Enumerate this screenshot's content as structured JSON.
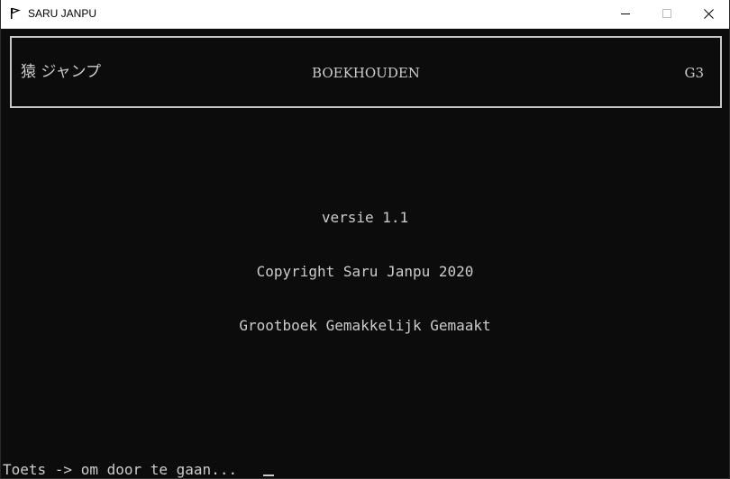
{
  "window": {
    "title": "SARU JANPU",
    "icon": "flag-icon",
    "controls": {
      "minimize_icon": "minimize-icon",
      "maximize_icon": "maximize-icon",
      "close_icon": "close-icon"
    }
  },
  "header": {
    "brand": "猿 ジャンプ",
    "title": "BOEKHOUDEN",
    "code": "G3"
  },
  "body": {
    "version": "versie 1.1",
    "copyright": "Copyright Saru Janpu 2020",
    "tagline": "Grootboek Gemakkelijk Gemaakt"
  },
  "prompt": {
    "text": "Toets -> om door te gaan..."
  },
  "colors": {
    "background": "#0c0c0c",
    "foreground": "#cccccc",
    "titlebar": "#ffffff"
  }
}
